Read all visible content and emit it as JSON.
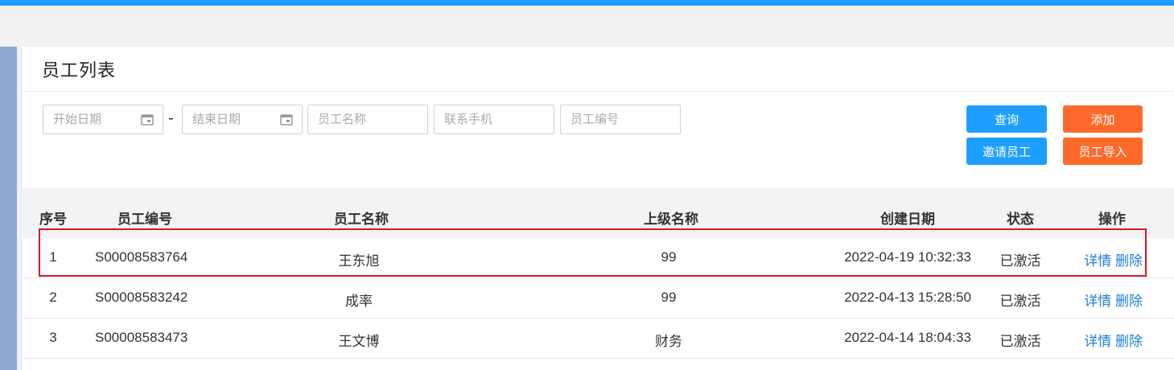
{
  "panel": {
    "title": "员工列表"
  },
  "filters": {
    "start_date_placeholder": "开始日期",
    "date_separator": "-",
    "end_date_placeholder": "结束日期",
    "name_placeholder": "员工名称",
    "phone_placeholder": "联系手机",
    "code_placeholder": "员工编号"
  },
  "buttons": {
    "query": "查询",
    "add": "添加",
    "invite": "邀请员工",
    "import": "员工导入"
  },
  "table": {
    "headers": {
      "index": "序号",
      "code": "员工编号",
      "name": "员工名称",
      "superior": "上级名称",
      "created": "创建日期",
      "status": "状态",
      "actions": "操作"
    },
    "rows": [
      {
        "index": "1",
        "code": "S00008583764",
        "name": "王东旭",
        "superior": "99",
        "created": "2022-04-19 10:32:33",
        "status": "已激活",
        "detail": "详情",
        "delete": "删除"
      },
      {
        "index": "2",
        "code": "S00008583242",
        "name": "成率",
        "superior": "99",
        "created": "2022-04-13 15:28:50",
        "status": "已激活",
        "detail": "详情",
        "delete": "删除"
      },
      {
        "index": "3",
        "code": "S00008583473",
        "name": "王文博",
        "superior": "财务",
        "created": "2022-04-14 18:04:33",
        "status": "已激活",
        "detail": "详情",
        "delete": "删除"
      }
    ]
  },
  "colors": {
    "accent_blue": "#1e9fff",
    "accent_orange": "#ff6a2a",
    "highlight_red": "#d9161c"
  }
}
